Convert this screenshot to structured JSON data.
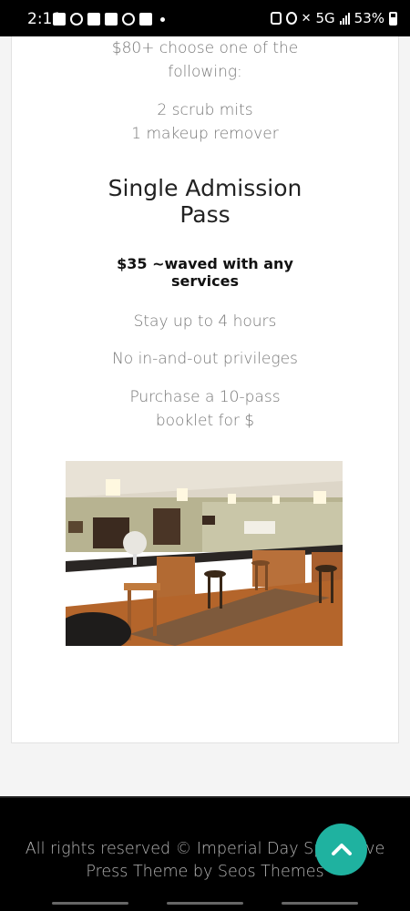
{
  "status_bar": {
    "time": "2:11",
    "network": "5G",
    "battery": "53%"
  },
  "content": {
    "intro_lines": [
      "$80+ choose one of the",
      "following:"
    ],
    "options": [
      "2 scrub mits",
      "1 makeup remover"
    ],
    "pass_title_lines": [
      "Single Admission",
      "Pass"
    ],
    "price_lines": [
      "$35 ~waved with any",
      "services"
    ],
    "features": [
      "Stay up to 4 hours",
      "No in-and-out privileges"
    ],
    "booklet_lines": [
      "Purchase a 10-pass",
      "booklet for $"
    ]
  },
  "footer": {
    "line1": "All rights reserved © Imperial Day Spa | Hive",
    "line2": "Press Theme by Seos Themes"
  },
  "icons": {
    "scroll_top": "chevron-up-icon"
  },
  "colors": {
    "accent": "#1fb2a0",
    "footer_bg": "#000000",
    "text_muted": "#777777"
  }
}
